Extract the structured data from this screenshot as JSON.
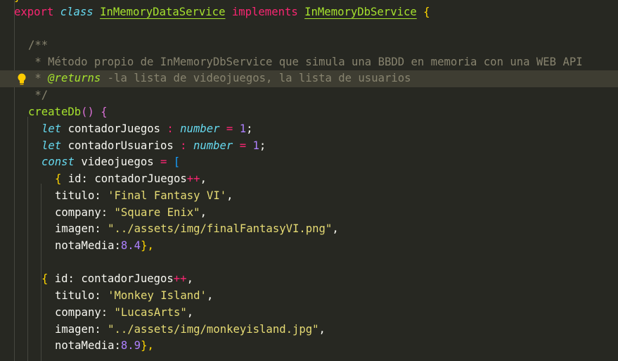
{
  "code": {
    "export_kw": "export",
    "class_kw": "class",
    "class_name": "InMemoryDataService",
    "implements_kw": "implements",
    "interface_name": "InMemoryDbService",
    "brace_open": "{",
    "jsdoc_open": "/**",
    "jsdoc_line1": " * Método propio de InMemoryDbService que simula una BBDD en memoria con una WEB API",
    "jsdoc_star": " * ",
    "returns_tag": "@returns",
    "returns_text": " -la lista de videojuegos, la lista de usuarios",
    "jsdoc_close": " */",
    "method_name": "createDb",
    "method_parens": "()",
    "method_brace": "{",
    "let_kw": "let",
    "var1": "contadorJuegos",
    "var2": "contadorUsuarios",
    "colon": ":",
    "type_number": "number",
    "eq": "=",
    "one": "1",
    "semi": ";",
    "const_kw": "const",
    "var3": "videojuegos",
    "bracket_open": "[",
    "obj_open": "{",
    "id_prop": "id: contadorJuegos",
    "incr": "++",
    "comma": ",",
    "titulo_prop": "titulo: ",
    "company_prop": "company: ",
    "imagen_prop": "imagen: ",
    "nota_prop": "notaMedia:",
    "close_obj": "},",
    "game1": {
      "titulo": "'Final Fantasy VI'",
      "company": "\"Square Enix\"",
      "imagen": "\"../assets/img/finalFantasyVI.png\"",
      "nota": "8.4"
    },
    "game2": {
      "titulo": "'Monkey Island'",
      "company": "\"LucasArts\"",
      "imagen": "\"../assets/img/monkeyisland.jpg\"",
      "nota": "8.9"
    }
  },
  "colors": {
    "background": "#272822",
    "current_line": "#3e3d32",
    "keyword": "#f92672",
    "string": "#e6db74",
    "number": "#ae81ff",
    "comment": "#88846f",
    "function": "#a6e22e",
    "type": "#66d9ef"
  },
  "icons": {
    "lightbulb": "lightbulb-icon"
  }
}
